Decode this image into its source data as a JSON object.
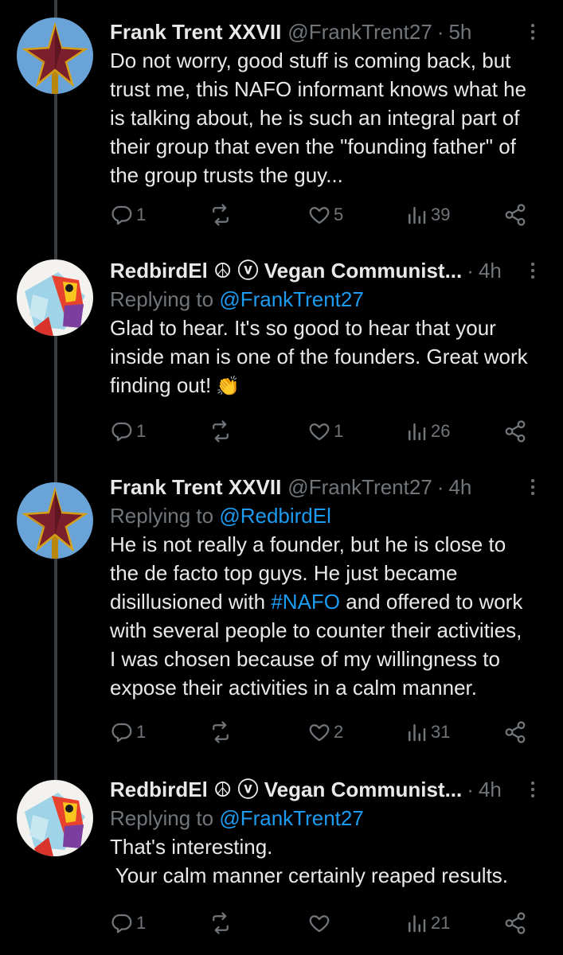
{
  "tweets": [
    {
      "name": "Frank Trent XXVII",
      "handle": "@FrankTrent27",
      "time": "5h",
      "replying_prefix": "",
      "replying_to": "",
      "text_lines": [
        "Do not worry, good stuff is coming back, but",
        "trust me, this NAFO informant knows what he",
        "is talking about, he is such an integral part of",
        "their group that even the \"founding father\" of",
        "the group trusts the guy..."
      ],
      "replies": "1",
      "retweets": "",
      "likes": "5",
      "views": "39",
      "avatar": "red-star-avatar"
    },
    {
      "name": "RedbirdEl ☮ ⓥ Vegan Communist...",
      "handle": "",
      "time": "4h",
      "replying_prefix": "Replying to",
      "replying_to": "@FrankTrent27",
      "text_lines": [
        "Glad to hear. It's so good to hear that your",
        "inside man is one of the founders. Great work",
        "finding out!"
      ],
      "emoji": "👏",
      "replies": "1",
      "retweets": "",
      "likes": "1",
      "views": "26",
      "avatar": "redbird-avatar"
    },
    {
      "name": "Frank Trent XXVII",
      "handle": "@FrankTrent27",
      "time": "4h",
      "replying_prefix": "Replying to",
      "replying_to": "@RedbirdEl",
      "text_lines": [
        "He is not really a founder, but he is close to",
        "the de facto top guys. He just became"
      ],
      "line3_before": "disillusioned with ",
      "line3_hashtag": "#NAFO",
      "line3_after": " and offered to work",
      "text_lines_after": [
        "with several people to counter their activities,",
        "I was chosen because of my willingness to",
        "expose their activities in a calm manner."
      ],
      "replies": "1",
      "retweets": "",
      "likes": "2",
      "views": "31",
      "avatar": "red-star-avatar"
    },
    {
      "name": "RedbirdEl ☮ ⓥ Vegan Communist...",
      "handle": "",
      "time": "4h",
      "replying_prefix": "Replying to",
      "replying_to": "@FrankTrent27",
      "text_lines": [
        "That's interesting.",
        " Your calm manner certainly reaped results."
      ],
      "replies": "1",
      "retweets": "",
      "likes": "",
      "views": "21",
      "avatar": "redbird-avatar"
    }
  ],
  "colors": {
    "background": "#000000",
    "text": "#e7e9ea",
    "muted": "#71767b",
    "link": "#1d9bf0",
    "thread_line": "#3a3d40"
  }
}
